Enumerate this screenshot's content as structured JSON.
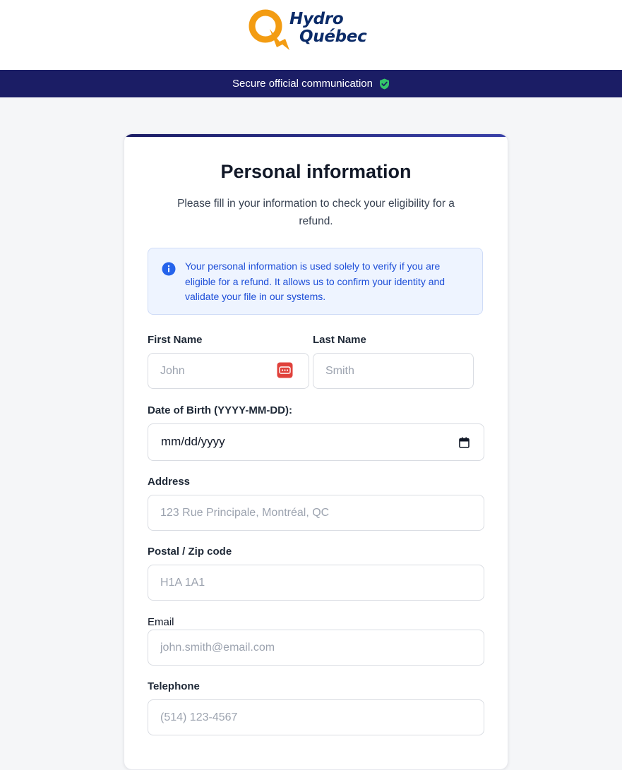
{
  "logo": {
    "line1": "Hydro",
    "line2": "Québec",
    "brand_orange": "#f39c12",
    "brand_navy": "#0b2b68"
  },
  "banner": {
    "text": "Secure official communication",
    "icon": "shield-check-icon",
    "icon_color": "#34c46a",
    "bg": "#1b1d65"
  },
  "form": {
    "title": "Personal information",
    "subtitle": "Please fill in your information to check your eligibility for a refund.",
    "info": {
      "icon": "info-icon",
      "text": "Your personal information is used solely to verify if you are eligible for a refund. It allows us to confirm your identity and validate your file in our systems."
    },
    "first_name": {
      "label": "First Name",
      "placeholder": "John",
      "value": "",
      "autofill_icon": "password-manager-icon"
    },
    "last_name": {
      "label": "Last Name",
      "placeholder": "Smith",
      "value": ""
    },
    "dob": {
      "label": "Date of Birth (YYYY-MM-DD):",
      "display": "mm/dd/yyyy",
      "icon": "calendar-icon"
    },
    "address": {
      "label": "Address",
      "placeholder": "123 Rue Principale, Montréal, QC",
      "value": ""
    },
    "postal": {
      "label": "Postal / Zip code",
      "placeholder": "H1A 1A1",
      "value": ""
    },
    "email": {
      "label": "Email",
      "placeholder": "john.smith@email.com",
      "value": ""
    },
    "telephone": {
      "label": "Telephone",
      "placeholder": "(514) 123-4567",
      "value": ""
    }
  }
}
